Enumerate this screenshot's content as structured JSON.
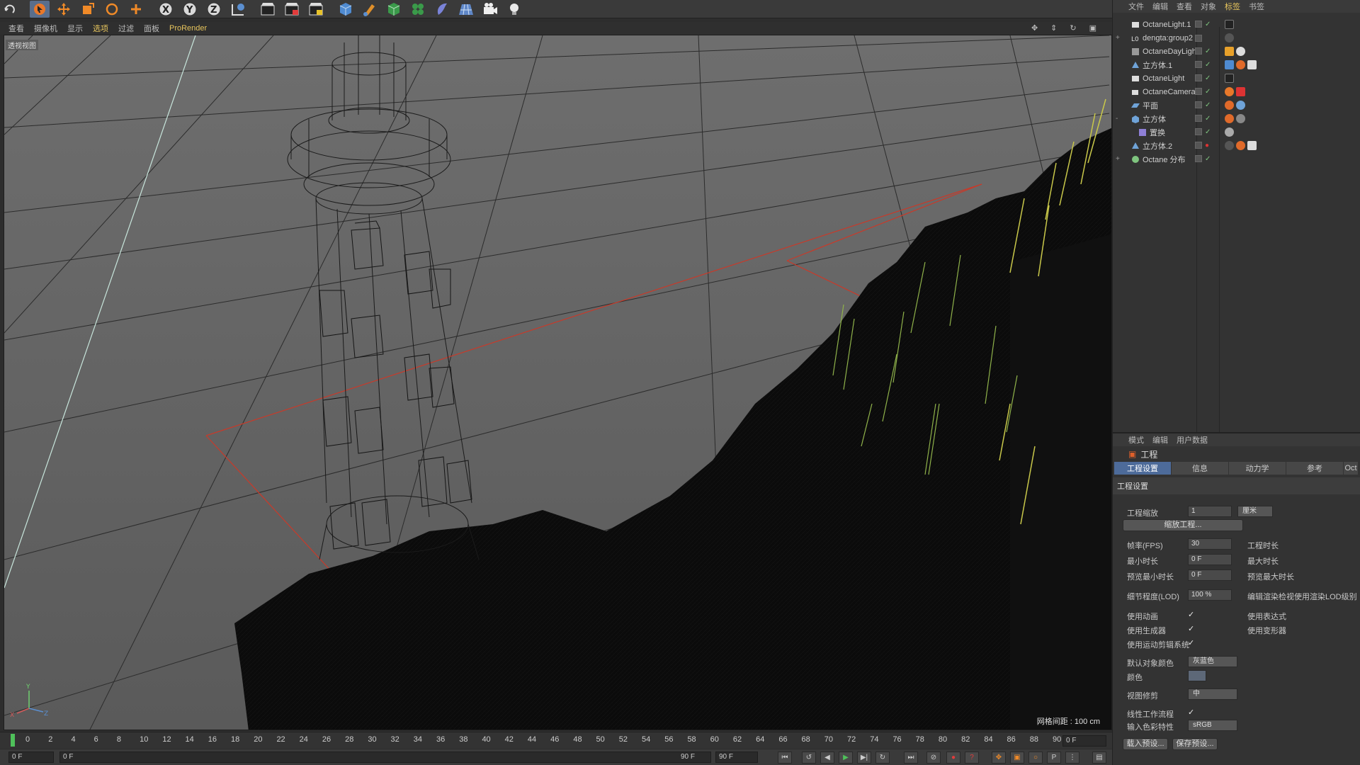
{
  "menu": {
    "viewport": [
      "查看",
      "摄像机",
      "显示",
      "选项",
      "过滤",
      "面板",
      "ProRender"
    ],
    "viewport_active_index": 3,
    "objects": [
      "文件",
      "编辑",
      "查看",
      "对象",
      "标签",
      "书签"
    ],
    "objects_active_index": 4,
    "attributes": [
      "模式",
      "编辑",
      "用户数据"
    ]
  },
  "toolbar": {
    "icons": [
      "undo-icon",
      "select-icon",
      "move-icon",
      "scale-icon",
      "rotate-icon",
      "add-icon",
      "x-axis-icon",
      "y-axis-icon",
      "z-axis-icon",
      "world-icon",
      "render-view-icon",
      "render-picture-icon",
      "render-settings-icon",
      "cube-icon",
      "pen-icon",
      "subdivide-icon",
      "cloner-icon",
      "deformer-icon",
      "environment-icon",
      "camera-icon",
      "light-icon"
    ]
  },
  "viewport": {
    "label": "透视视图",
    "grid_spacing": "网格间距 : 100 cm"
  },
  "objects": [
    {
      "name": "OctaneLight.1",
      "expander": "",
      "icon_color": "#cfcfcf"
    },
    {
      "name": "dengta:group2",
      "expander": "+",
      "icon_color": "#cfcfcf"
    },
    {
      "name": "OctaneDayLight",
      "expander": "",
      "icon_color": "#cfcfcf"
    },
    {
      "name": "立方体.1",
      "expander": "",
      "icon_color": "#6fa3d8"
    },
    {
      "name": "OctaneLight",
      "expander": "",
      "icon_color": "#cfcfcf"
    },
    {
      "name": "OctaneCamera",
      "expander": "",
      "icon_color": "#cfcfcf"
    },
    {
      "name": "平面",
      "expander": "",
      "icon_color": "#6fa3d8"
    },
    {
      "name": "立方体",
      "expander": "-",
      "icon_color": "#6fa3d8"
    },
    {
      "name": "置换",
      "expander": "",
      "icon_color": "#8e7fd6"
    },
    {
      "name": "立方体.2",
      "expander": "",
      "icon_color": "#6fa3d8"
    },
    {
      "name": "Octane 分布",
      "expander": "+",
      "icon_color": "#7fc57f"
    }
  ],
  "attributes": {
    "title": "工程",
    "tabs": [
      "工程设置",
      "信息",
      "动力学",
      "参考",
      "Oct"
    ],
    "active_tab": 0,
    "section": "工程设置",
    "scale_label": "工程缩放",
    "scale_value": "1",
    "scale_unit": "厘米",
    "scale_button": "缩放工程...",
    "fps_label": "帧率(FPS)",
    "fps_value": "30",
    "duration_label": "工程时长",
    "min_time_label": "最小时长",
    "min_time_value": "0 F",
    "max_time_label": "最大时长",
    "preview_min_label": "预览最小时长",
    "preview_min_value": "0 F",
    "preview_max_label": "预览最大时长",
    "lod_label": "细节程度(LOD)",
    "lod_value": "100 %",
    "lod_note": "编辑渲染检视使用渲染LOD级别",
    "use_anim_label": "使用动画",
    "use_expr_label": "使用表达式",
    "use_gen_label": "使用生成器",
    "use_deform_label": "使用变形器",
    "use_motion_label": "使用运动剪辑系统",
    "default_color_label": "默认对象颜色",
    "default_color_value": "灰蓝色",
    "color_label": "颜色",
    "view_clip_label": "视图修剪",
    "view_clip_value": "中",
    "linear_label": "线性工作流程",
    "input_color_label": "输入色彩特性",
    "input_color_value": "sRGB",
    "load_preset": "载入预设...",
    "save_preset": "保存预设..."
  },
  "timeline": {
    "ticks": [
      "0",
      "2",
      "4",
      "6",
      "8",
      "10",
      "12",
      "14",
      "16",
      "18",
      "20",
      "22",
      "24",
      "26",
      "28",
      "30",
      "32",
      "34",
      "36",
      "38",
      "40",
      "42",
      "44",
      "46",
      "48",
      "50",
      "52",
      "54",
      "56",
      "58",
      "60",
      "62",
      "64",
      "66",
      "68",
      "70",
      "72",
      "74",
      "76",
      "78",
      "80",
      "82",
      "84",
      "86",
      "88",
      "90"
    ],
    "current_frame": "0 F",
    "start_frame": "0 F",
    "range_start": "0 F",
    "range_end": "90 F",
    "end_frame": "90 F"
  },
  "colors": {
    "accent": "#e7c55d",
    "tab_active": "#4d6b9a",
    "playhead": "#4fc15a"
  }
}
